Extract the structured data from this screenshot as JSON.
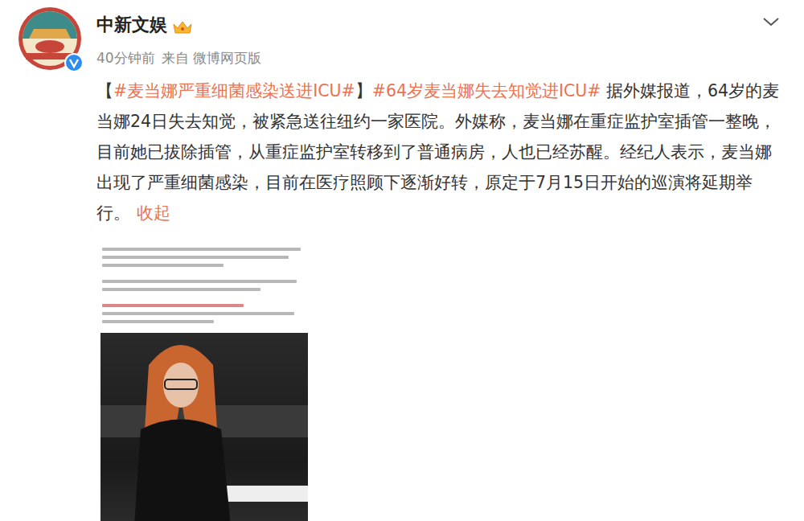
{
  "account": {
    "name": "中新文娱",
    "verified": true,
    "time": "40分钟前",
    "source": "来自 微博网页版"
  },
  "post": {
    "segments": [
      {
        "text": "【",
        "kind": "plain"
      },
      {
        "text": "#麦当娜严重细菌感染送进ICU#",
        "kind": "tag"
      },
      {
        "text": "】",
        "kind": "plain"
      },
      {
        "text": "#64岁麦当娜失去知觉进ICU#",
        "kind": "tag"
      },
      {
        "text": " 据外媒报道，64岁的麦当娜24日失去知觉，被紧急送往纽约一家医院。外媒称，麦当娜在重症监护室插管一整晚，目前她已拔除插管，从重症监护室转移到了普通病房，人也已经苏醒。经纪人表示，麦当娜出现了严重细菌感染，目前在医疗照顾下逐渐好转，原定于7月15日开始的巡演将延期举行。",
        "kind": "plain"
      },
      {
        "text": "收起",
        "kind": "link"
      }
    ]
  }
}
